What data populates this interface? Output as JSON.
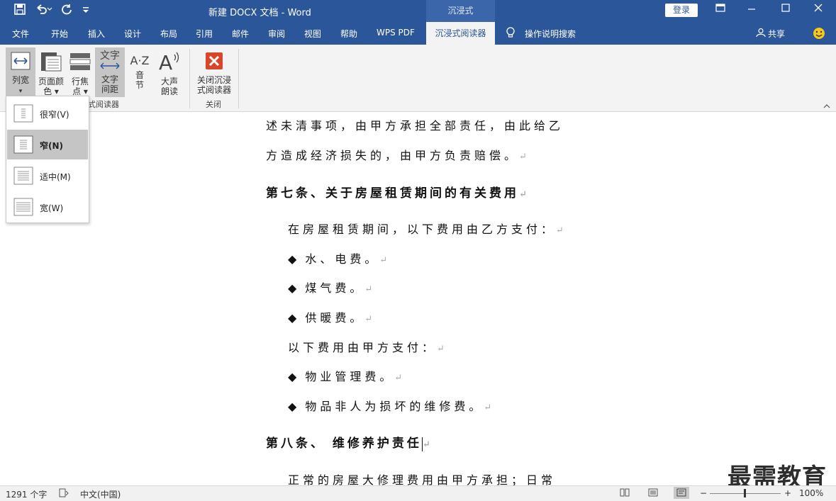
{
  "titlebar": {
    "title": "新建 DOCX 文档  -  Word",
    "context_tab": "沉浸式",
    "login_label": "登录",
    "accent": "#2b579a"
  },
  "tabs": [
    "文件",
    "开始",
    "插入",
    "设计",
    "布局",
    "引用",
    "邮件",
    "审阅",
    "视图",
    "帮助",
    "WPS PDF",
    "沉浸式阅读器"
  ],
  "tell_me": "操作说明搜索",
  "share": "共享",
  "ribbon": {
    "column_width": {
      "line1": "列宽",
      "caret": "▾"
    },
    "page_color": {
      "line1": "页面颜",
      "line2": "色 ▾"
    },
    "line_focus": {
      "line1": "行焦",
      "line2": "点 ▾"
    },
    "text_spacing": {
      "line1": "文字",
      "line2": "间距",
      "icon_text": "文字"
    },
    "syllables": {
      "line1": "音",
      "line2": "节",
      "icon_text": "A·Z"
    },
    "read_aloud": {
      "line1": "大声",
      "line2": "朗读"
    },
    "close_reader": {
      "line1": "关闭沉浸",
      "line2": "式阅读器"
    },
    "group_reader": "式阅读器",
    "group_close": "关闭"
  },
  "dropdown": {
    "items": [
      {
        "label": "很窄(V)",
        "selected": false
      },
      {
        "label": "窄(N)",
        "selected": true
      },
      {
        "label": "适中(M)",
        "selected": false
      },
      {
        "label": "宽(W)",
        "selected": false
      }
    ]
  },
  "document": {
    "l1": "述未清事项，由甲方承担全部责任，由此给乙",
    "l2": "方造成经济损失的，由甲方负责赔偿。",
    "h1": "第七条、关于房屋租赁期间的有关费用",
    "l3": "在房屋租赁期间，以下费用由乙方支付：",
    "b1": "水、电费。",
    "b2": "煤气费。",
    "b3": "供暖费。",
    "l4": "以下费用由甲方支付：",
    "b4": "物业管理费。",
    "b5": "物品非人为损坏的维修费。",
    "h2": "第八条、 维修养护责任",
    "l5": "正常的房屋大修理费用由甲方承担；日常",
    "paragraph_mark": "↵",
    "bullet": "◆"
  },
  "status": {
    "word_count": "1291 个字",
    "language": "中文(中国)",
    "zoom": "100%",
    "zoom_minus": "−",
    "zoom_plus": "+"
  },
  "watermark": "最需教育"
}
